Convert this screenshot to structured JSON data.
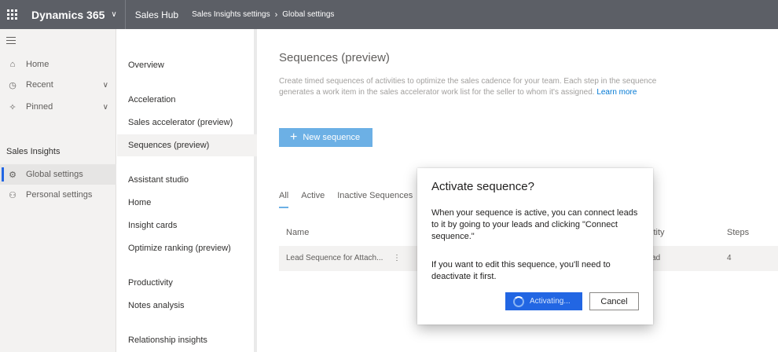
{
  "topbar": {
    "waffle_icon": "app-launcher-icon",
    "app_name": "Dynamics 365",
    "app_chevron": "∨",
    "module": "Sales Hub",
    "breadcrumb": [
      "Sales Insights settings",
      "Global settings"
    ],
    "breadcrumb_sep": "›",
    "background": "#5c5f66"
  },
  "leftnav": {
    "items": [
      {
        "label": "Home",
        "icon": "⌂"
      },
      {
        "label": "Recent",
        "icon": "◷",
        "chevron": "∨"
      },
      {
        "label": "Pinned",
        "icon": "✧",
        "chevron": "∨"
      }
    ],
    "section": "Sales Insights",
    "section_items": [
      {
        "label": "Global settings",
        "icon": "⚙"
      },
      {
        "label": "Personal settings",
        "icon": "⚇"
      }
    ]
  },
  "settingsnav": {
    "overview": "Overview",
    "groups": [
      {
        "heading": "Acceleration",
        "items": [
          "Sales accelerator (preview)",
          "Sequences (preview)"
        ]
      },
      {
        "heading": "Assistant studio",
        "items": [
          "Home",
          "Insight cards",
          "Optimize ranking (preview)"
        ]
      },
      {
        "heading": "Productivity",
        "items": [
          "Notes analysis"
        ]
      },
      {
        "heading": "Relationship insights",
        "items": []
      }
    ]
  },
  "main": {
    "title": "Sequences (preview)",
    "description": "Create timed sequences of activities to optimize the sales cadence for your team. Each step in the sequence generates a work item in the sales accelerator work list for the seller to whom it's assigned.",
    "learn_more": "Learn more",
    "new_button": "New sequence",
    "new_button_icon": "+",
    "tabs": [
      "All",
      "Active",
      "Inactive Sequences"
    ],
    "columns": {
      "name": "Name",
      "entity": "Entity",
      "steps": "Steps"
    },
    "rows": [
      {
        "name": "Lead Sequence for Attach...",
        "more": "⋮",
        "entity": "Lead",
        "steps": "4"
      }
    ]
  },
  "modal": {
    "title": "Activate sequence?",
    "body1": "When your sequence is active, you can connect leads to it by going to your leads and clicking \"Connect sequence.\"",
    "body2": "If you want to edit this sequence, you'll need to deactivate it first.",
    "primary_label": "Activating...",
    "cancel_label": "Cancel",
    "primary_color": "#2266e3"
  }
}
